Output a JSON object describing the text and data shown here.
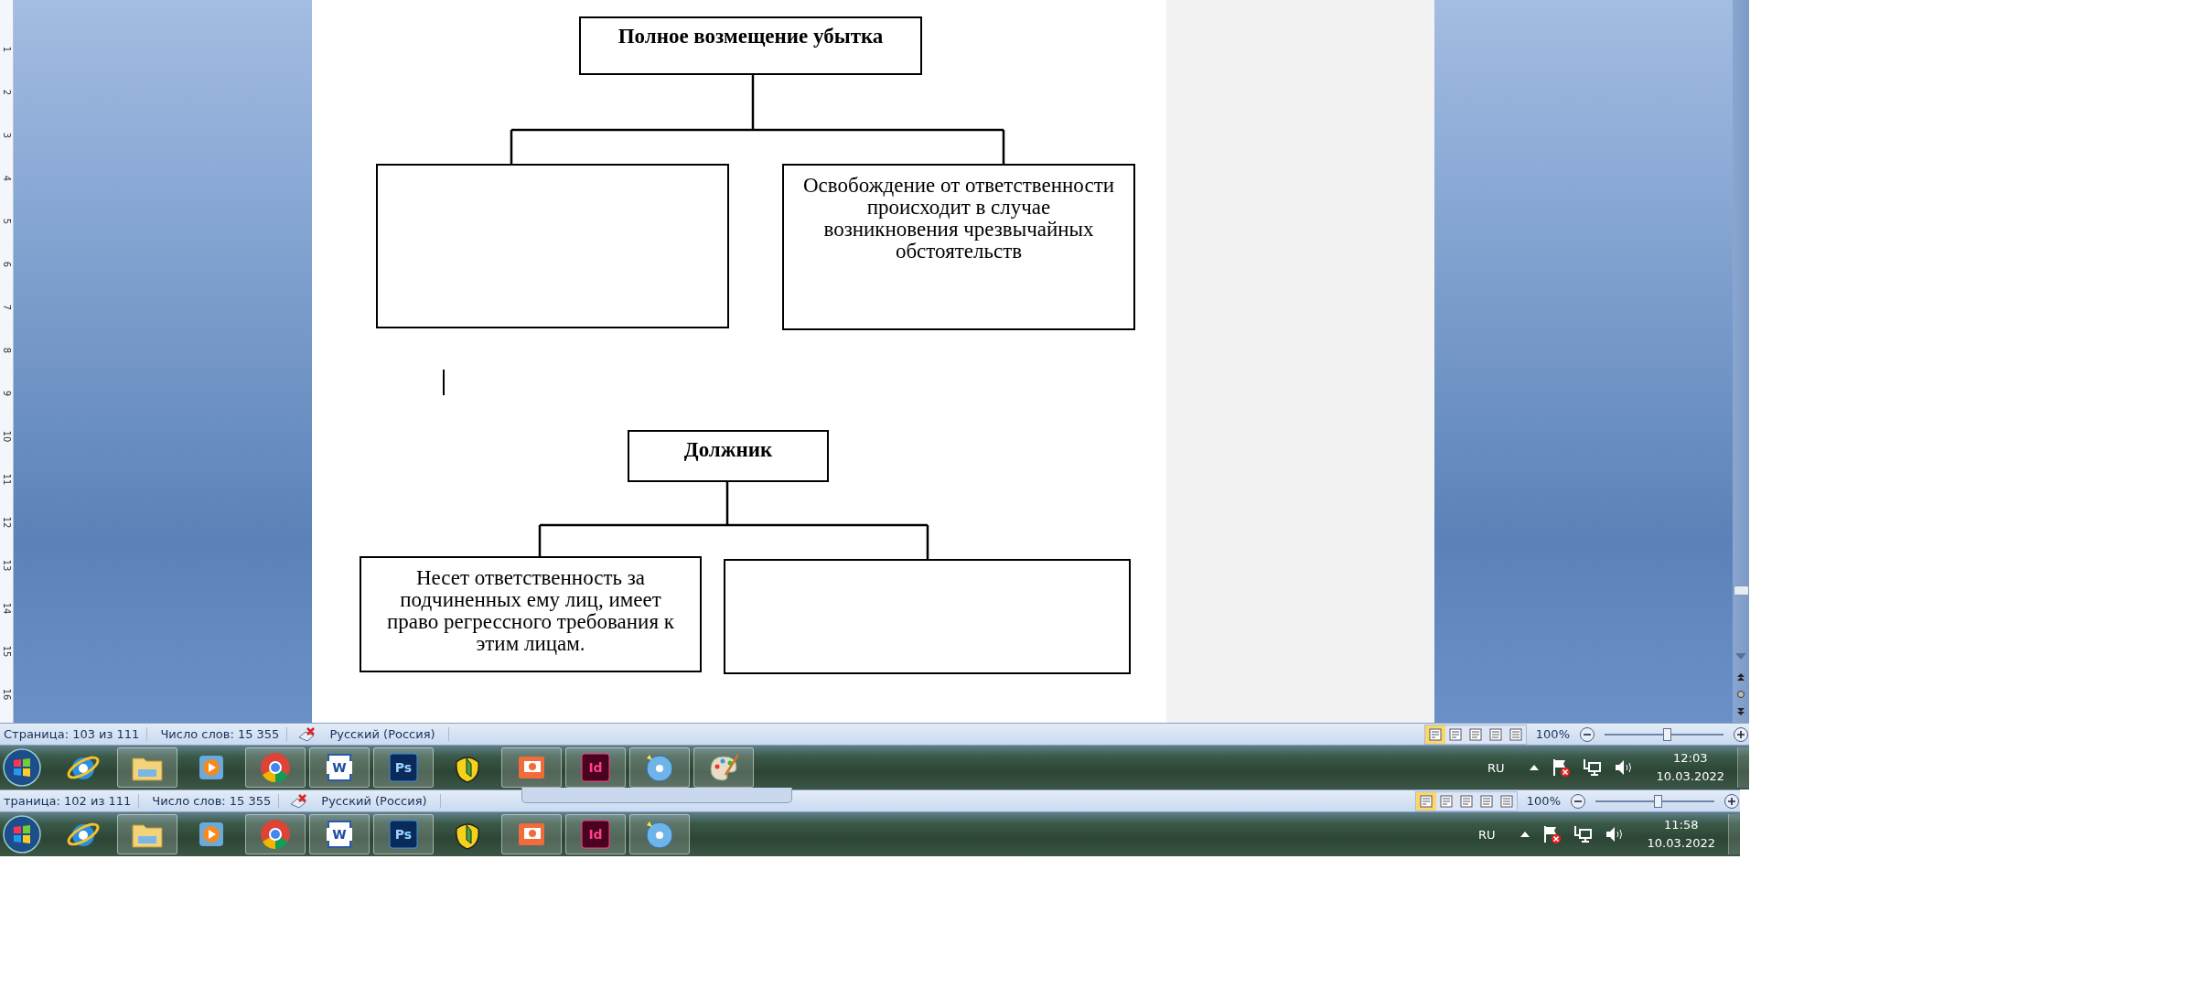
{
  "ruler": {
    "numbers": [
      "1",
      "2",
      "3",
      "4",
      "5",
      "6",
      "7",
      "8",
      "9",
      "10",
      "11",
      "12",
      "13",
      "14",
      "15",
      "16"
    ]
  },
  "document": {
    "diagrams": [
      {
        "root": "Полное возмещение убытка",
        "children": [
          {
            "kind": "blank"
          },
          {
            "kind": "text",
            "text": "Освобождение от ответственности происходит в случае возникновения чрезвычайных обстоятельств"
          }
        ]
      },
      {
        "root": "Должник",
        "children": [
          {
            "kind": "text",
            "text": "Несет ответственность за подчиненных ему лиц, имеет право регрессного требования к этим лицам."
          },
          {
            "kind": "blank"
          }
        ]
      }
    ]
  },
  "status_bars": [
    {
      "page": "Страница: 103 из 111",
      "words": "Число слов: 15 355",
      "language": "Русский (Россия)",
      "views": [
        {
          "selected": true
        },
        {
          "selected": false
        },
        {
          "selected": false
        },
        {
          "selected": false
        },
        {
          "selected": false
        }
      ],
      "zoom": {
        "reading": "100%",
        "level": 0.52
      }
    },
    {
      "page": "траница: 102 из 111",
      "words": "Число слов: 15 355",
      "language": "Русский (Россия)",
      "views": [
        {
          "selected": true
        },
        {
          "selected": false
        },
        {
          "selected": false
        },
        {
          "selected": false
        },
        {
          "selected": false
        }
      ],
      "zoom": {
        "reading": "100%",
        "level": 0.52
      }
    }
  ],
  "taskbars": [
    {
      "apps": [
        {
          "kind": "ie",
          "open": false
        },
        {
          "kind": "folder",
          "open": true
        },
        {
          "kind": "media",
          "open": false
        },
        {
          "kind": "chrome",
          "open": true
        },
        {
          "kind": "word",
          "label": "W",
          "open": true
        },
        {
          "kind": "ps",
          "label": "Ps",
          "open": true
        },
        {
          "kind": "leaf",
          "open": false
        },
        {
          "kind": "slides",
          "open": true
        },
        {
          "kind": "id",
          "label": "Id",
          "open": true
        },
        {
          "kind": "disc",
          "open": true
        },
        {
          "kind": "palette",
          "open": true
        }
      ],
      "tray": {
        "language": "RU",
        "time": "12:03",
        "date": "10.03.2022"
      }
    },
    {
      "apps": [
        {
          "kind": "ie",
          "open": false
        },
        {
          "kind": "folder",
          "open": true
        },
        {
          "kind": "media",
          "open": false
        },
        {
          "kind": "chrome",
          "open": true
        },
        {
          "kind": "word",
          "label": "W",
          "open": true
        },
        {
          "kind": "ps",
          "label": "Ps",
          "open": true
        },
        {
          "kind": "leaf",
          "open": false
        },
        {
          "kind": "slides",
          "open": true
        },
        {
          "kind": "id",
          "label": "Id",
          "open": true
        },
        {
          "kind": "disc",
          "open": true
        }
      ],
      "tray": {
        "language": "RU",
        "time": "11:58",
        "date": "10.03.2022"
      }
    }
  ]
}
